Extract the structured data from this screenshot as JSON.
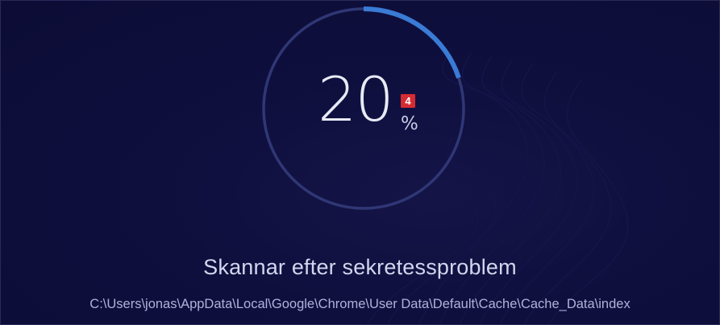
{
  "scan": {
    "progress_percent": 20,
    "progress_value": "20",
    "percent_symbol": "%",
    "badge_count": "4",
    "status_title": "Skannar efter sekretessproblem",
    "current_path": "C:\\Users\\jonas\\AppData\\Local\\Google\\Chrome\\User Data\\Default\\Cache\\Cache_Data\\index"
  },
  "colors": {
    "background": "#0f0f3e",
    "ring_track": "#2f3775",
    "ring_progress": "#3a7bd5",
    "badge": "#d62b32",
    "text_primary": "#e8eaf6",
    "text_secondary": "#aeb3d9"
  }
}
